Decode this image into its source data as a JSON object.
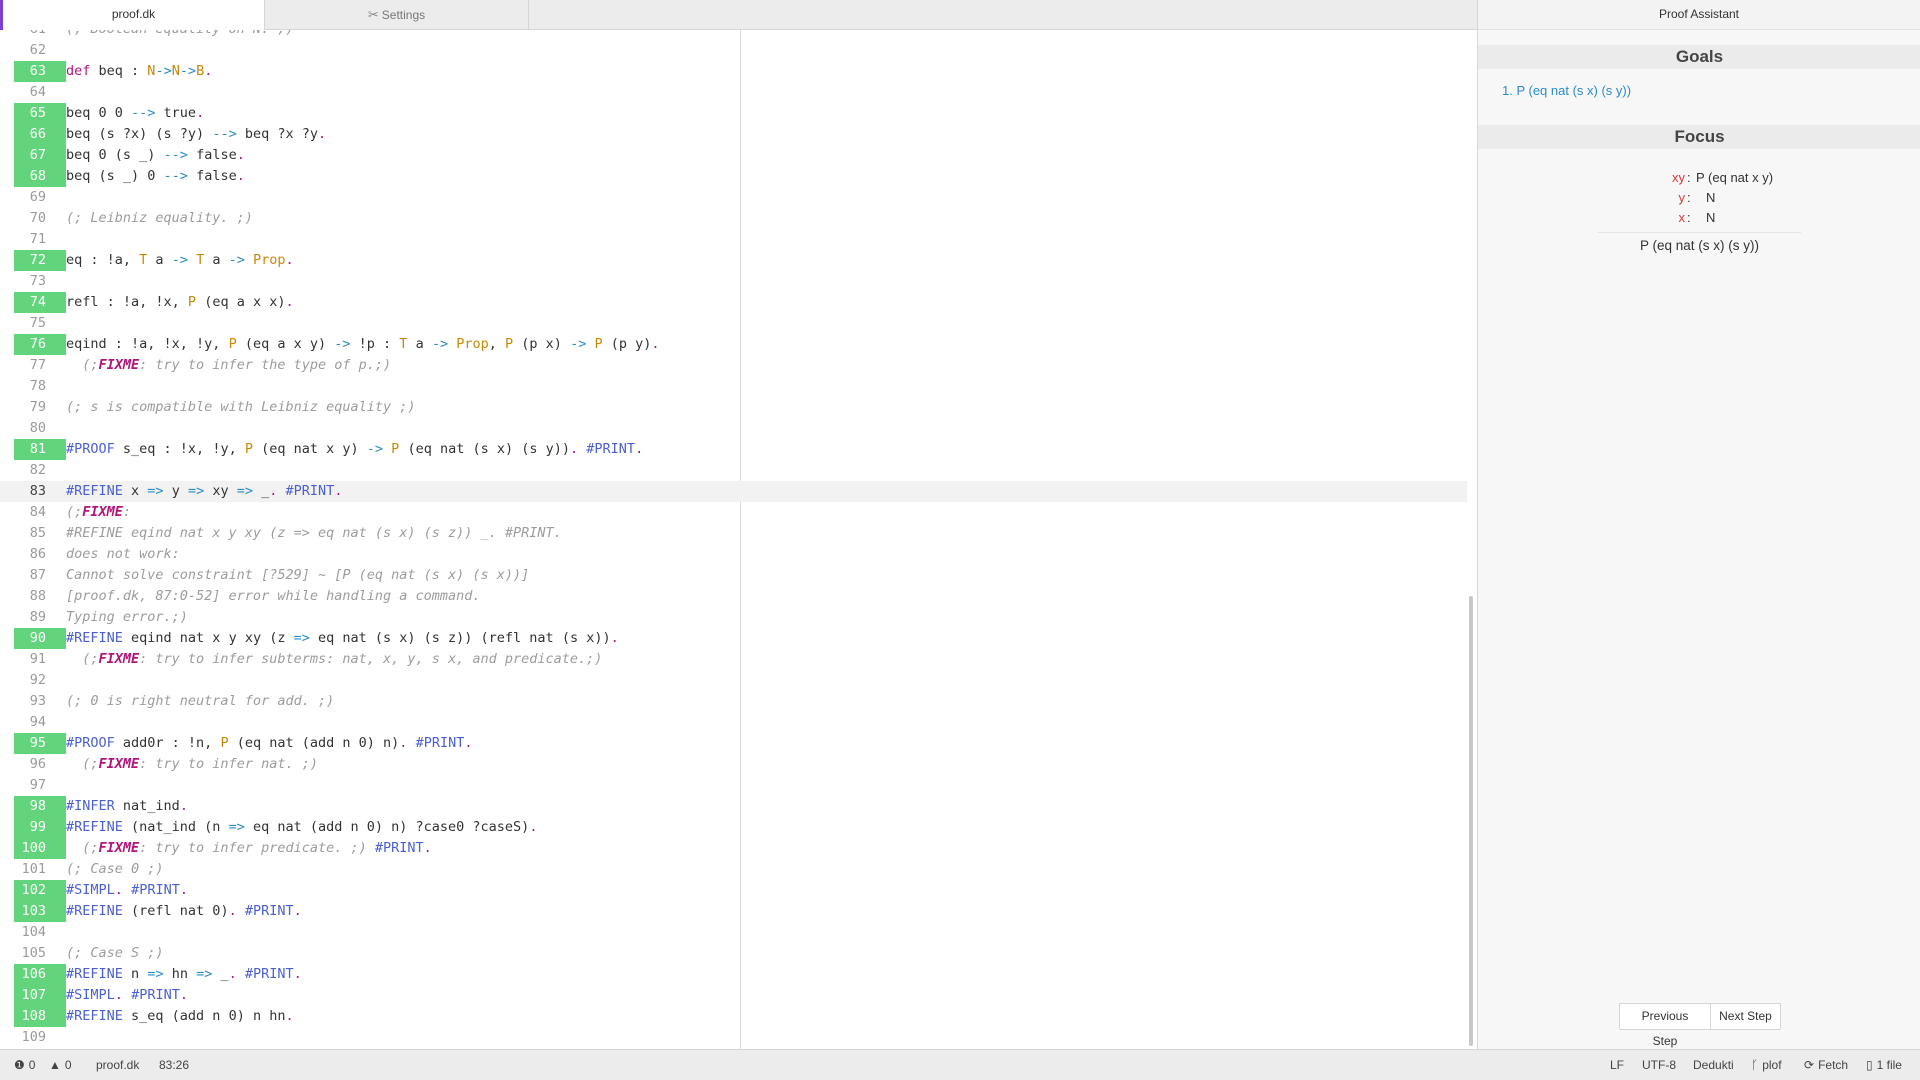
{
  "tabs": [
    {
      "label": "proof.dk",
      "active": true
    },
    {
      "label": "Settings",
      "icon": "wrench-icon",
      "active": false
    }
  ],
  "editor": {
    "cursor_line": 83,
    "lines": [
      {
        "n": 61,
        "checked": false,
        "tokens": [
          [
            "cm",
            "(; Boolean equality on N. ;)"
          ]
        ]
      },
      {
        "n": 62,
        "checked": false,
        "tokens": []
      },
      {
        "n": 63,
        "checked": true,
        "tokens": [
          [
            "kw",
            "def"
          ],
          [
            "p",
            " beq : "
          ],
          [
            "ty",
            "N"
          ],
          [
            "op",
            "->"
          ],
          [
            "ty",
            "N"
          ],
          [
            "op",
            "->"
          ],
          [
            "ty",
            "B"
          ],
          [
            "kw",
            "."
          ]
        ]
      },
      {
        "n": 64,
        "checked": false,
        "tokens": []
      },
      {
        "n": 65,
        "checked": true,
        "tokens": [
          [
            "p",
            "beq 0 0 "
          ],
          [
            "op",
            "-->"
          ],
          [
            "p",
            " true"
          ],
          [
            "kw",
            "."
          ]
        ]
      },
      {
        "n": 66,
        "checked": true,
        "tokens": [
          [
            "p",
            "beq (s ?x) (s ?y) "
          ],
          [
            "op",
            "-->"
          ],
          [
            "p",
            " beq ?x ?y"
          ],
          [
            "kw",
            "."
          ]
        ]
      },
      {
        "n": 67,
        "checked": true,
        "tokens": [
          [
            "p",
            "beq 0 (s _) "
          ],
          [
            "op",
            "-->"
          ],
          [
            "p",
            " false"
          ],
          [
            "kw",
            "."
          ]
        ]
      },
      {
        "n": 68,
        "checked": true,
        "tokens": [
          [
            "p",
            "beq (s _) 0 "
          ],
          [
            "op",
            "-->"
          ],
          [
            "p",
            " false"
          ],
          [
            "kw",
            "."
          ]
        ]
      },
      {
        "n": 69,
        "checked": false,
        "tokens": []
      },
      {
        "n": 70,
        "checked": false,
        "tokens": [
          [
            "cm",
            "(; Leibniz equality. ;)"
          ]
        ]
      },
      {
        "n": 71,
        "checked": false,
        "tokens": []
      },
      {
        "n": 72,
        "checked": true,
        "tokens": [
          [
            "p",
            "eq : !a, "
          ],
          [
            "ty",
            "T"
          ],
          [
            "p",
            " a "
          ],
          [
            "op",
            "->"
          ],
          [
            "p",
            " "
          ],
          [
            "ty",
            "T"
          ],
          [
            "p",
            " a "
          ],
          [
            "op",
            "->"
          ],
          [
            "p",
            " "
          ],
          [
            "ty",
            "Prop"
          ],
          [
            "kw",
            "."
          ]
        ]
      },
      {
        "n": 73,
        "checked": false,
        "tokens": []
      },
      {
        "n": 74,
        "checked": true,
        "tokens": [
          [
            "p",
            "refl : !a, !x, "
          ],
          [
            "ty",
            "P"
          ],
          [
            "p",
            " (eq a x x)"
          ],
          [
            "kw",
            "."
          ]
        ]
      },
      {
        "n": 75,
        "checked": false,
        "tokens": []
      },
      {
        "n": 76,
        "checked": true,
        "tokens": [
          [
            "p",
            "eqind : !a, !x, !y, "
          ],
          [
            "ty",
            "P"
          ],
          [
            "p",
            " (eq a x y) "
          ],
          [
            "op",
            "->"
          ],
          [
            "p",
            " !p : "
          ],
          [
            "ty",
            "T"
          ],
          [
            "p",
            " a "
          ],
          [
            "op",
            "->"
          ],
          [
            "p",
            " "
          ],
          [
            "ty",
            "Prop"
          ],
          [
            "p",
            ", "
          ],
          [
            "ty",
            "P"
          ],
          [
            "p",
            " (p x) "
          ],
          [
            "op",
            "->"
          ],
          [
            "p",
            " "
          ],
          [
            "ty",
            "P"
          ],
          [
            "p",
            " (p y)"
          ],
          [
            "kw",
            "."
          ]
        ]
      },
      {
        "n": 77,
        "checked": false,
        "tokens": [
          [
            "cm",
            "  (;"
          ],
          [
            "fix",
            "FIXME"
          ],
          [
            "cm",
            ": try to infer the type of p.;)"
          ]
        ]
      },
      {
        "n": 78,
        "checked": false,
        "tokens": []
      },
      {
        "n": 79,
        "checked": false,
        "tokens": [
          [
            "cm",
            "(; s is compatible with Leibniz equality ;)"
          ]
        ]
      },
      {
        "n": 80,
        "checked": false,
        "tokens": []
      },
      {
        "n": 81,
        "checked": true,
        "tokens": [
          [
            "dir",
            "#PROOF"
          ],
          [
            "p",
            " s_eq : !x, !y, "
          ],
          [
            "ty",
            "P"
          ],
          [
            "p",
            " (eq nat x y) "
          ],
          [
            "op",
            "->"
          ],
          [
            "p",
            " "
          ],
          [
            "ty",
            "P"
          ],
          [
            "p",
            " (eq nat (s x) (s y))"
          ],
          [
            "kw",
            "."
          ],
          [
            "p",
            " "
          ],
          [
            "dir",
            "#PRINT"
          ],
          [
            "kw",
            "."
          ]
        ]
      },
      {
        "n": 82,
        "checked": false,
        "tokens": []
      },
      {
        "n": 83,
        "checked": false,
        "tokens": [
          [
            "dir",
            "#REFINE"
          ],
          [
            "p",
            " x "
          ],
          [
            "op",
            "=>"
          ],
          [
            "p",
            " y "
          ],
          [
            "op",
            "=>"
          ],
          [
            "p",
            " xy "
          ],
          [
            "op",
            "=>"
          ],
          [
            "p",
            " _"
          ],
          [
            "kw",
            "."
          ],
          [
            "p",
            " "
          ],
          [
            "dir",
            "#PRINT"
          ],
          [
            "kw",
            "."
          ]
        ]
      },
      {
        "n": 84,
        "checked": false,
        "tokens": [
          [
            "cm",
            "(;"
          ],
          [
            "fix",
            "FIXME"
          ],
          [
            "cm",
            ":"
          ]
        ]
      },
      {
        "n": 85,
        "checked": false,
        "tokens": [
          [
            "cm",
            "#REFINE eqind nat x y xy (z => eq nat (s x) (s z)) _. #PRINT."
          ]
        ]
      },
      {
        "n": 86,
        "checked": false,
        "tokens": [
          [
            "cm",
            "does not work:"
          ]
        ]
      },
      {
        "n": 87,
        "checked": false,
        "tokens": [
          [
            "cm",
            "Cannot solve constraint [?529] ~ [P (eq nat (s x) (s x))]"
          ]
        ]
      },
      {
        "n": 88,
        "checked": false,
        "tokens": [
          [
            "cm",
            "[proof.dk, 87:0-52] error while handling a command."
          ]
        ]
      },
      {
        "n": 89,
        "checked": false,
        "tokens": [
          [
            "cm",
            "Typing error.;)"
          ]
        ]
      },
      {
        "n": 90,
        "checked": true,
        "tokens": [
          [
            "dir",
            "#REFINE"
          ],
          [
            "p",
            " eqind nat x y xy (z "
          ],
          [
            "op",
            "=>"
          ],
          [
            "p",
            " eq nat (s x) (s z)) (refl nat (s x))"
          ],
          [
            "kw",
            "."
          ]
        ]
      },
      {
        "n": 91,
        "checked": false,
        "tokens": [
          [
            "cm",
            "  (;"
          ],
          [
            "fix",
            "FIXME"
          ],
          [
            "cm",
            ": try to infer subterms: nat, x, y, s x, and predicate.;)"
          ]
        ]
      },
      {
        "n": 92,
        "checked": false,
        "tokens": []
      },
      {
        "n": 93,
        "checked": false,
        "tokens": [
          [
            "cm",
            "(; 0 is right neutral for add. ;)"
          ]
        ]
      },
      {
        "n": 94,
        "checked": false,
        "tokens": []
      },
      {
        "n": 95,
        "checked": true,
        "tokens": [
          [
            "dir",
            "#PROOF"
          ],
          [
            "p",
            " add0r : !n, "
          ],
          [
            "ty",
            "P"
          ],
          [
            "p",
            " (eq nat (add n 0) n)"
          ],
          [
            "kw",
            "."
          ],
          [
            "p",
            " "
          ],
          [
            "dir",
            "#PRINT"
          ],
          [
            "kw",
            "."
          ]
        ]
      },
      {
        "n": 96,
        "checked": false,
        "tokens": [
          [
            "cm",
            "  (;"
          ],
          [
            "fix",
            "FIXME"
          ],
          [
            "cm",
            ": try to infer nat. ;)"
          ]
        ]
      },
      {
        "n": 97,
        "checked": false,
        "tokens": []
      },
      {
        "n": 98,
        "checked": true,
        "tokens": [
          [
            "dir",
            "#INFER"
          ],
          [
            "p",
            " nat_ind"
          ],
          [
            "kw",
            "."
          ]
        ]
      },
      {
        "n": 99,
        "checked": true,
        "tokens": [
          [
            "dir",
            "#REFINE"
          ],
          [
            "p",
            " (nat_ind (n "
          ],
          [
            "op",
            "=>"
          ],
          [
            "p",
            " eq nat (add n 0) n) ?case0 ?caseS)"
          ],
          [
            "kw",
            "."
          ]
        ]
      },
      {
        "n": 100,
        "checked": true,
        "tokens": [
          [
            "cm",
            "  (;"
          ],
          [
            "fix",
            "FIXME"
          ],
          [
            "cm",
            ": try to infer predicate. ;)"
          ],
          [
            "p",
            " "
          ],
          [
            "dir",
            "#PRINT"
          ],
          [
            "kw",
            "."
          ]
        ]
      },
      {
        "n": 101,
        "checked": false,
        "tokens": [
          [
            "cm",
            "(; Case 0 ;)"
          ]
        ]
      },
      {
        "n": 102,
        "checked": true,
        "tokens": [
          [
            "dir",
            "#SIMPL"
          ],
          [
            "kw",
            "."
          ],
          [
            "p",
            " "
          ],
          [
            "dir",
            "#PRINT"
          ],
          [
            "kw",
            "."
          ]
        ]
      },
      {
        "n": 103,
        "checked": true,
        "tokens": [
          [
            "dir",
            "#REFINE"
          ],
          [
            "p",
            " (refl nat 0)"
          ],
          [
            "kw",
            "."
          ],
          [
            "p",
            " "
          ],
          [
            "dir",
            "#PRINT"
          ],
          [
            "kw",
            "."
          ]
        ]
      },
      {
        "n": 104,
        "checked": false,
        "tokens": []
      },
      {
        "n": 105,
        "checked": false,
        "tokens": [
          [
            "cm",
            "(; Case S ;)"
          ]
        ]
      },
      {
        "n": 106,
        "checked": true,
        "tokens": [
          [
            "dir",
            "#REFINE"
          ],
          [
            "p",
            " n "
          ],
          [
            "op",
            "=>"
          ],
          [
            "p",
            " hn "
          ],
          [
            "op",
            "=>"
          ],
          [
            "p",
            " _"
          ],
          [
            "kw",
            "."
          ],
          [
            "p",
            " "
          ],
          [
            "dir",
            "#PRINT"
          ],
          [
            "kw",
            "."
          ]
        ]
      },
      {
        "n": 107,
        "checked": true,
        "tokens": [
          [
            "dir",
            "#SIMPL"
          ],
          [
            "kw",
            "."
          ],
          [
            "p",
            " "
          ],
          [
            "dir",
            "#PRINT"
          ],
          [
            "kw",
            "."
          ]
        ]
      },
      {
        "n": 108,
        "checked": true,
        "tokens": [
          [
            "dir",
            "#REFINE"
          ],
          [
            "p",
            " s_eq (add n 0) n hn"
          ],
          [
            "kw",
            "."
          ]
        ]
      },
      {
        "n": 109,
        "checked": false,
        "tokens": []
      }
    ]
  },
  "panel": {
    "title": "Proof Assistant",
    "goals_heading": "Goals",
    "goals": [
      "1. P (eq nat (s x) (s y))"
    ],
    "focus_heading": "Focus",
    "hypotheses": [
      {
        "name": "xy",
        "type": "P (eq nat x y)"
      },
      {
        "name": "y",
        "type": "N"
      },
      {
        "name": "x",
        "type": "N"
      }
    ],
    "focus_goal": "P (eq nat (s x) (s y))",
    "prev_label": "Previous Step",
    "next_label": "Next Step"
  },
  "statusbar": {
    "errors": "0",
    "warnings": "0",
    "file": "proof.dk",
    "position": "83:26",
    "line_ending": "LF",
    "encoding": "UTF-8",
    "grammar": "Dedukti",
    "branch": "plof",
    "fetch": "Fetch",
    "files": "1 file"
  },
  "colors": {
    "checked_gutter": "#62d47c",
    "keyword": "#b0177a",
    "type": "#c8880a",
    "operator": "#2b8bc9",
    "directive": "#4b5fd0",
    "comment": "#9c9c9c",
    "hypothesis_name": "#d93a3a",
    "goal_link": "#2b8bc9",
    "tab_accent": "#7b3fd6"
  }
}
